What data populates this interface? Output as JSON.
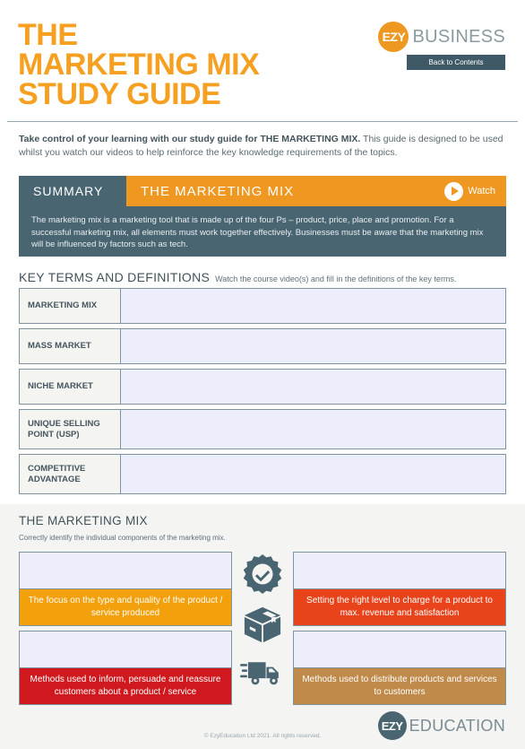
{
  "header": {
    "title_lines": [
      "THE",
      "MARKETING MIX",
      "STUDY GUIDE"
    ],
    "brand_badge": "EZY",
    "brand_word": "BUSINESS",
    "back_button": "Back to Contents",
    "accent_orange": "#EE9721",
    "dark_slate": "#4A6572"
  },
  "intro": {
    "bold_part": "Take control of your learning with our study guide for THE MARKETING MIX.",
    "rest_part": " This guide is designed to be used whilst you watch our videos to help reinforce the key knowledge requirements of the topics."
  },
  "summary": {
    "tab_label": "SUMMARY",
    "topic_label": "THE MARKETING MIX",
    "watch_label": "Watch",
    "body": "The marketing mix is a marketing tool that is made up of the four Ps – product, price, place and promotion. For a successful marketing mix, all elements must work together effectively. Businesses must be aware that the marketing mix will be influenced by factors such as tech."
  },
  "key_terms": {
    "heading": "KEY TERMS AND DEFINITIONS",
    "subheading": "Watch the course video(s) and fill in the definitions of the key terms.",
    "rows": [
      {
        "term": "MARKETING MIX",
        "definition": ""
      },
      {
        "term": "MASS MARKET",
        "definition": ""
      },
      {
        "term": "NICHE MARKET",
        "definition": ""
      },
      {
        "term": "UNIQUE SELLING POINT (USP)",
        "definition": ""
      },
      {
        "term": "COMPETITIVE ADVANTAGE",
        "definition": ""
      }
    ]
  },
  "marketing_mix": {
    "heading": "THE MARKETING MIX",
    "subheading": "Correctly identify the individual components of the marketing mix.",
    "cards": [
      {
        "answer": "",
        "description": "The focus on the type and quality of the product / service produced",
        "color": "#F2A00C"
      },
      {
        "answer": "",
        "description": "Setting the right level to charge for a product to max. revenue and satisfaction",
        "color": "#E8431A"
      },
      {
        "answer": "",
        "description": "Methods used to inform, persuade and reassure customers about a product / service",
        "color": "#D0191E"
      },
      {
        "answer": "",
        "description": "Methods used to distribute products and services to customers",
        "color": "#C08A4A"
      }
    ],
    "icons": [
      "quality-badge-icon",
      "package-box-icon",
      "delivery-truck-icon"
    ]
  },
  "footer": {
    "copyright": "© EzyEducation Ltd 2021. All rights reserved.",
    "brand_badge": "EZY",
    "brand_word": "EDUCATION"
  }
}
